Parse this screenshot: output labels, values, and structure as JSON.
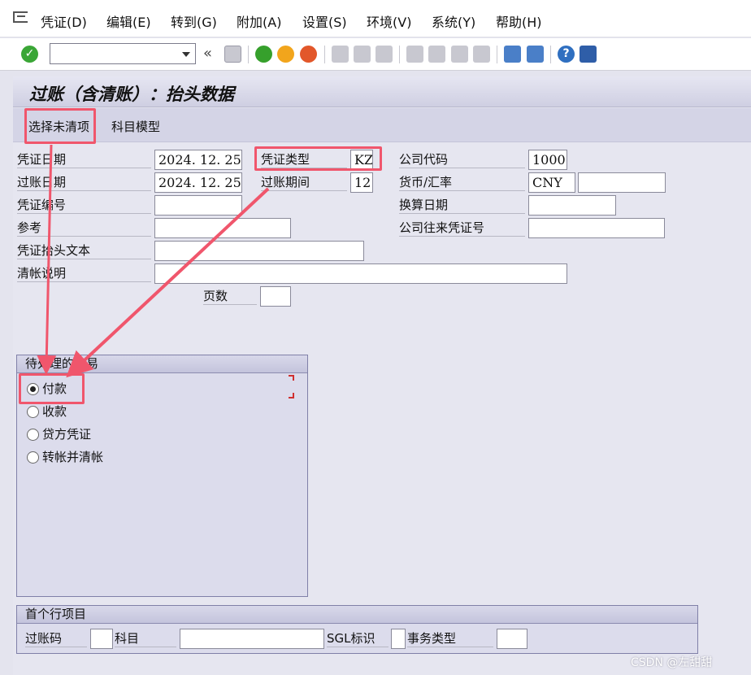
{
  "menu": {
    "items": [
      "凭证(D)",
      "编辑(E)",
      "转到(G)",
      "附加(A)",
      "设置(S)",
      "环境(V)",
      "系统(Y)",
      "帮助(H)"
    ]
  },
  "toolbar": {
    "command_value": "",
    "icons": [
      "confirm-icon",
      "command-dropdown-icon",
      "back-double-icon",
      "save-icon",
      "back-icon",
      "exit-icon",
      "cancel-icon",
      "print-icon",
      "find-icon",
      "find-next-icon",
      "first-page-icon",
      "previous-page-icon",
      "next-page-icon",
      "last-page-icon",
      "create-session-icon",
      "shortcut-icon",
      "help-icon",
      "customize-layout-icon"
    ],
    "back_glyph": "«"
  },
  "title": "过账（含清账）：抬头数据",
  "app_toolbar": {
    "select_open_items": "选择未清项",
    "account_model": "科目模型"
  },
  "header": {
    "doc_date": {
      "label": "凭证日期",
      "value": "2024. 12. 25"
    },
    "doc_type": {
      "label": "凭证类型",
      "value": "KZ"
    },
    "company_code": {
      "label": "公司代码",
      "value": "1000"
    },
    "posting_date": {
      "label": "过账日期",
      "value": "2024. 12. 25"
    },
    "period": {
      "label": "过账期间",
      "value": "12"
    },
    "currency": {
      "label": "货币/汇率",
      "value": "CNY",
      "rate_value": ""
    },
    "doc_number": {
      "label": "凭证编号",
      "value": ""
    },
    "translation_date": {
      "label": "换算日期",
      "value": ""
    },
    "reference": {
      "label": "参考",
      "value": ""
    },
    "cross_cc": {
      "label": "公司往来凭证号",
      "value": ""
    },
    "header_text": {
      "label": "凭证抬头文本",
      "value": ""
    },
    "clearing_text": {
      "label": "清帐说明",
      "value": ""
    },
    "pages": {
      "label": "页数",
      "value": ""
    }
  },
  "transaction_group": {
    "title": "待处理的交易",
    "options": [
      "付款",
      "收款",
      "贷方凭证",
      "转帐并清帐"
    ],
    "selected": "付款"
  },
  "first_line_item": {
    "title": "首个行项目",
    "posting_key": {
      "label": "过账码",
      "value": ""
    },
    "account": {
      "label": "科目",
      "value": ""
    },
    "sgl": {
      "label": "SGL标识",
      "value": ""
    },
    "trans_type": {
      "label": "事务类型",
      "value": ""
    }
  },
  "watermark": "CSDN @左甜甜",
  "colors": {
    "highlight": "#f0566c",
    "title_bar": "#d4d4e6",
    "background": "#e6e6f0"
  }
}
